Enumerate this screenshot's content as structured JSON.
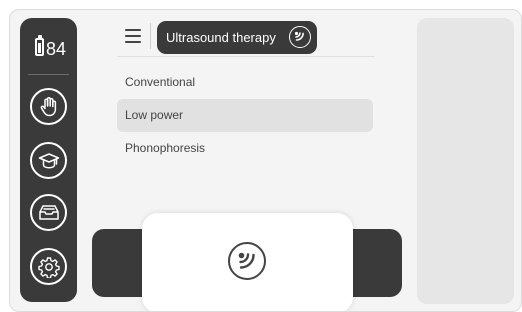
{
  "status": {
    "battery_level": "84",
    "battery_fill_fraction": 0.84
  },
  "sidebar": {
    "buttons": [
      {
        "name": "hand-icon"
      },
      {
        "name": "graduation-cap-icon"
      },
      {
        "name": "archive-box-icon"
      },
      {
        "name": "gear-icon"
      }
    ]
  },
  "header": {
    "menu_icon": "hamburger-menu-icon",
    "title": "Ultrasound therapy",
    "title_icon": "ultrasound-icon"
  },
  "menu": {
    "items": [
      {
        "label": "Conventional",
        "selected": false
      },
      {
        "label": "Low power",
        "selected": true
      },
      {
        "label": "Phonophoresis",
        "selected": false
      }
    ]
  },
  "bottom": {
    "icon": "ultrasound-icon"
  },
  "colors": {
    "dark": "#3a3a3a",
    "background": "#f4f4f4",
    "selected_row": "#e1e1e1",
    "panel": "#e6e6e6"
  }
}
